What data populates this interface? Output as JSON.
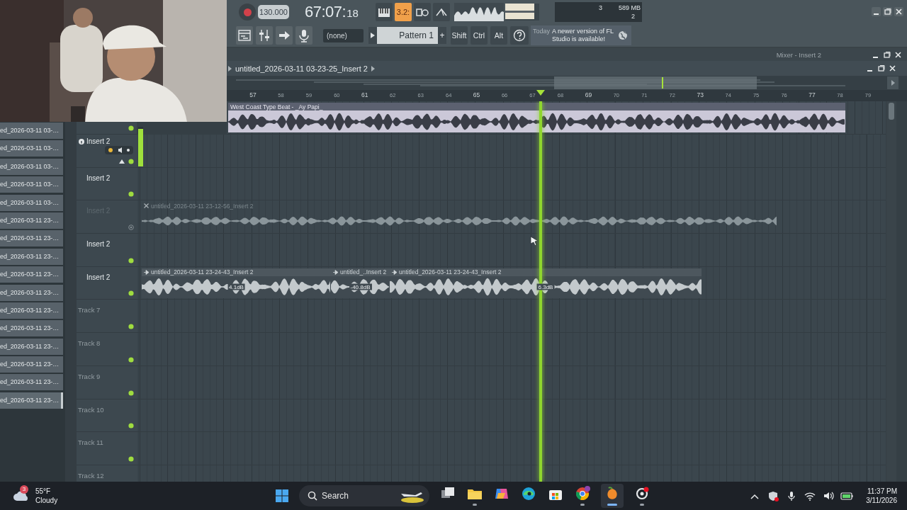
{
  "transport": {
    "record": {
      "on": false
    },
    "tempo": "130.000",
    "time": "67:07:",
    "time_ticks": "18",
    "buttons": [
      {
        "kind": "piano",
        "on": false
      },
      {
        "kind": "snap",
        "label": "3.2:",
        "on": true
      },
      {
        "kind": "loop",
        "on": false
      },
      {
        "kind": "metronome",
        "on": false
      }
    ],
    "output_meter": {
      "level": 0.85
    },
    "monitor": {
      "top_value": "3",
      "memory": "589 MB",
      "bottom_value": "2"
    }
  },
  "toolbar": {
    "buttons": [
      {
        "kind": "playlist"
      },
      {
        "kind": "mixer"
      },
      {
        "kind": "arrow"
      },
      {
        "kind": "microphone"
      }
    ],
    "channel": "(none)",
    "pattern": "Pattern 1",
    "pattern_add": "+",
    "modifiers": [
      "Shift",
      "Ctrl",
      "Alt"
    ],
    "hint": {
      "day": "Today",
      "text": "A newer version of FL Studio is available!"
    }
  },
  "mixer_window": {
    "title": "Mixer - Insert 2"
  },
  "playlist": {
    "title": "untitled_2026-03-11 03-23-25_Insert 2",
    "ruler": [
      "57",
      "58",
      "59",
      "60",
      "61",
      "62",
      "63",
      "64",
      "65",
      "66",
      "67",
      "68",
      "69",
      "70",
      "71",
      "72",
      "73",
      "74",
      "75",
      "76",
      "77",
      "78",
      "79"
    ],
    "playhead": {
      "level": 0.539
    },
    "meter": {
      "level": 0.95
    },
    "tracks": [
      {
        "kind": "track",
        "muted": false,
        "clips": [
          {
            "name": "West Coast Type Beat - _Ay Papi_",
            "selected": true,
            "muted": false
          }
        ]
      },
      {
        "kind": "strip",
        "label": "Insert 2",
        "muted": false
      },
      {
        "kind": "track",
        "label": "Insert 2",
        "muted": false
      },
      {
        "kind": "track",
        "label": "Insert 2",
        "muted": true,
        "clips": [
          {
            "name": "untitled_2026-03-11 23-12-56_Insert 2",
            "selected": false,
            "muted": true
          }
        ]
      },
      {
        "kind": "track",
        "label": "Insert 2",
        "muted": false
      },
      {
        "kind": "track",
        "label": "Insert 2",
        "muted": false,
        "clips": [
          {
            "name": "untitled_2026-03-11 23-24-43_Insert 2",
            "selected": false,
            "muted": false,
            "volume": "4.1dB"
          },
          {
            "name": "untitled_..Insert 2",
            "selected": false,
            "muted": false,
            "volume": "-40.8dB"
          },
          {
            "name": "untitled_2026-03-11 23-24-43_Insert 2",
            "selected": false,
            "muted": false,
            "volume": "6.3dB"
          }
        ]
      },
      {
        "kind": "empty",
        "label": "Track 7",
        "muted": false
      },
      {
        "kind": "empty",
        "label": "Track 8",
        "muted": false
      },
      {
        "kind": "empty",
        "label": "Track 9",
        "muted": false
      },
      {
        "kind": "empty",
        "label": "Track 10",
        "muted": false
      },
      {
        "kind": "empty",
        "label": "Track 11",
        "muted": false
      },
      {
        "kind": "empty",
        "label": "Track 12"
      }
    ]
  },
  "browser": {
    "items": [
      {
        "name": "ed_2026-03-11 03-…",
        "selected": false
      },
      {
        "name": "ed_2026-03-11 03-…",
        "selected": false
      },
      {
        "name": "ed_2026-03-11 03-…",
        "selected": false
      },
      {
        "name": "ed_2026-03-11 03-…",
        "selected": false
      },
      {
        "name": "ed_2026-03-11 03-…",
        "selected": false
      },
      {
        "name": "ed_2026-03-11 23-…",
        "selected": false
      },
      {
        "name": "ed_2026-03-11 23-…",
        "selected": false
      },
      {
        "name": "ed_2026-03-11 23-…",
        "selected": false
      },
      {
        "name": "ed_2026-03-11 23-…",
        "selected": false
      },
      {
        "name": "ed_2026-03-11 23-…",
        "selected": false
      },
      {
        "name": "ed_2026-03-11 23-…",
        "selected": false
      },
      {
        "name": "ed_2026-03-11 23-…",
        "selected": false
      },
      {
        "name": "ed_2026-03-11 23-…",
        "selected": false
      },
      {
        "name": "ed_2026-03-11 23-…",
        "selected": false
      },
      {
        "name": "ed_2026-03-11 23-…",
        "selected": false
      },
      {
        "name": "ed_2026-03-11 23-…",
        "selected": true
      }
    ]
  },
  "taskbar": {
    "weather": {
      "badge": "3",
      "temperature": "55°F",
      "condition": "Cloudy"
    },
    "search": {
      "placeholder": "Search"
    },
    "apps": [
      {
        "kind": "taskview",
        "running": false,
        "selected": false
      },
      {
        "kind": "explorer",
        "running": true,
        "selected": false
      },
      {
        "kind": "copilot",
        "running": false,
        "selected": false
      },
      {
        "kind": "edge",
        "running": false,
        "selected": false
      },
      {
        "kind": "store",
        "running": false,
        "selected": false
      },
      {
        "kind": "chrome",
        "running": true,
        "selected": false
      },
      {
        "kind": "fl",
        "running": true,
        "selected": true
      },
      {
        "kind": "recorder",
        "running": true,
        "selected": false
      }
    ],
    "tray": [
      {
        "kind": "chevron"
      },
      {
        "kind": "security"
      },
      {
        "kind": "microphone"
      },
      {
        "kind": "wifi"
      },
      {
        "kind": "speaker"
      },
      {
        "kind": "battery"
      }
    ],
    "clock": {
      "time": "11:37 PM",
      "date": "3/11/2026"
    }
  }
}
